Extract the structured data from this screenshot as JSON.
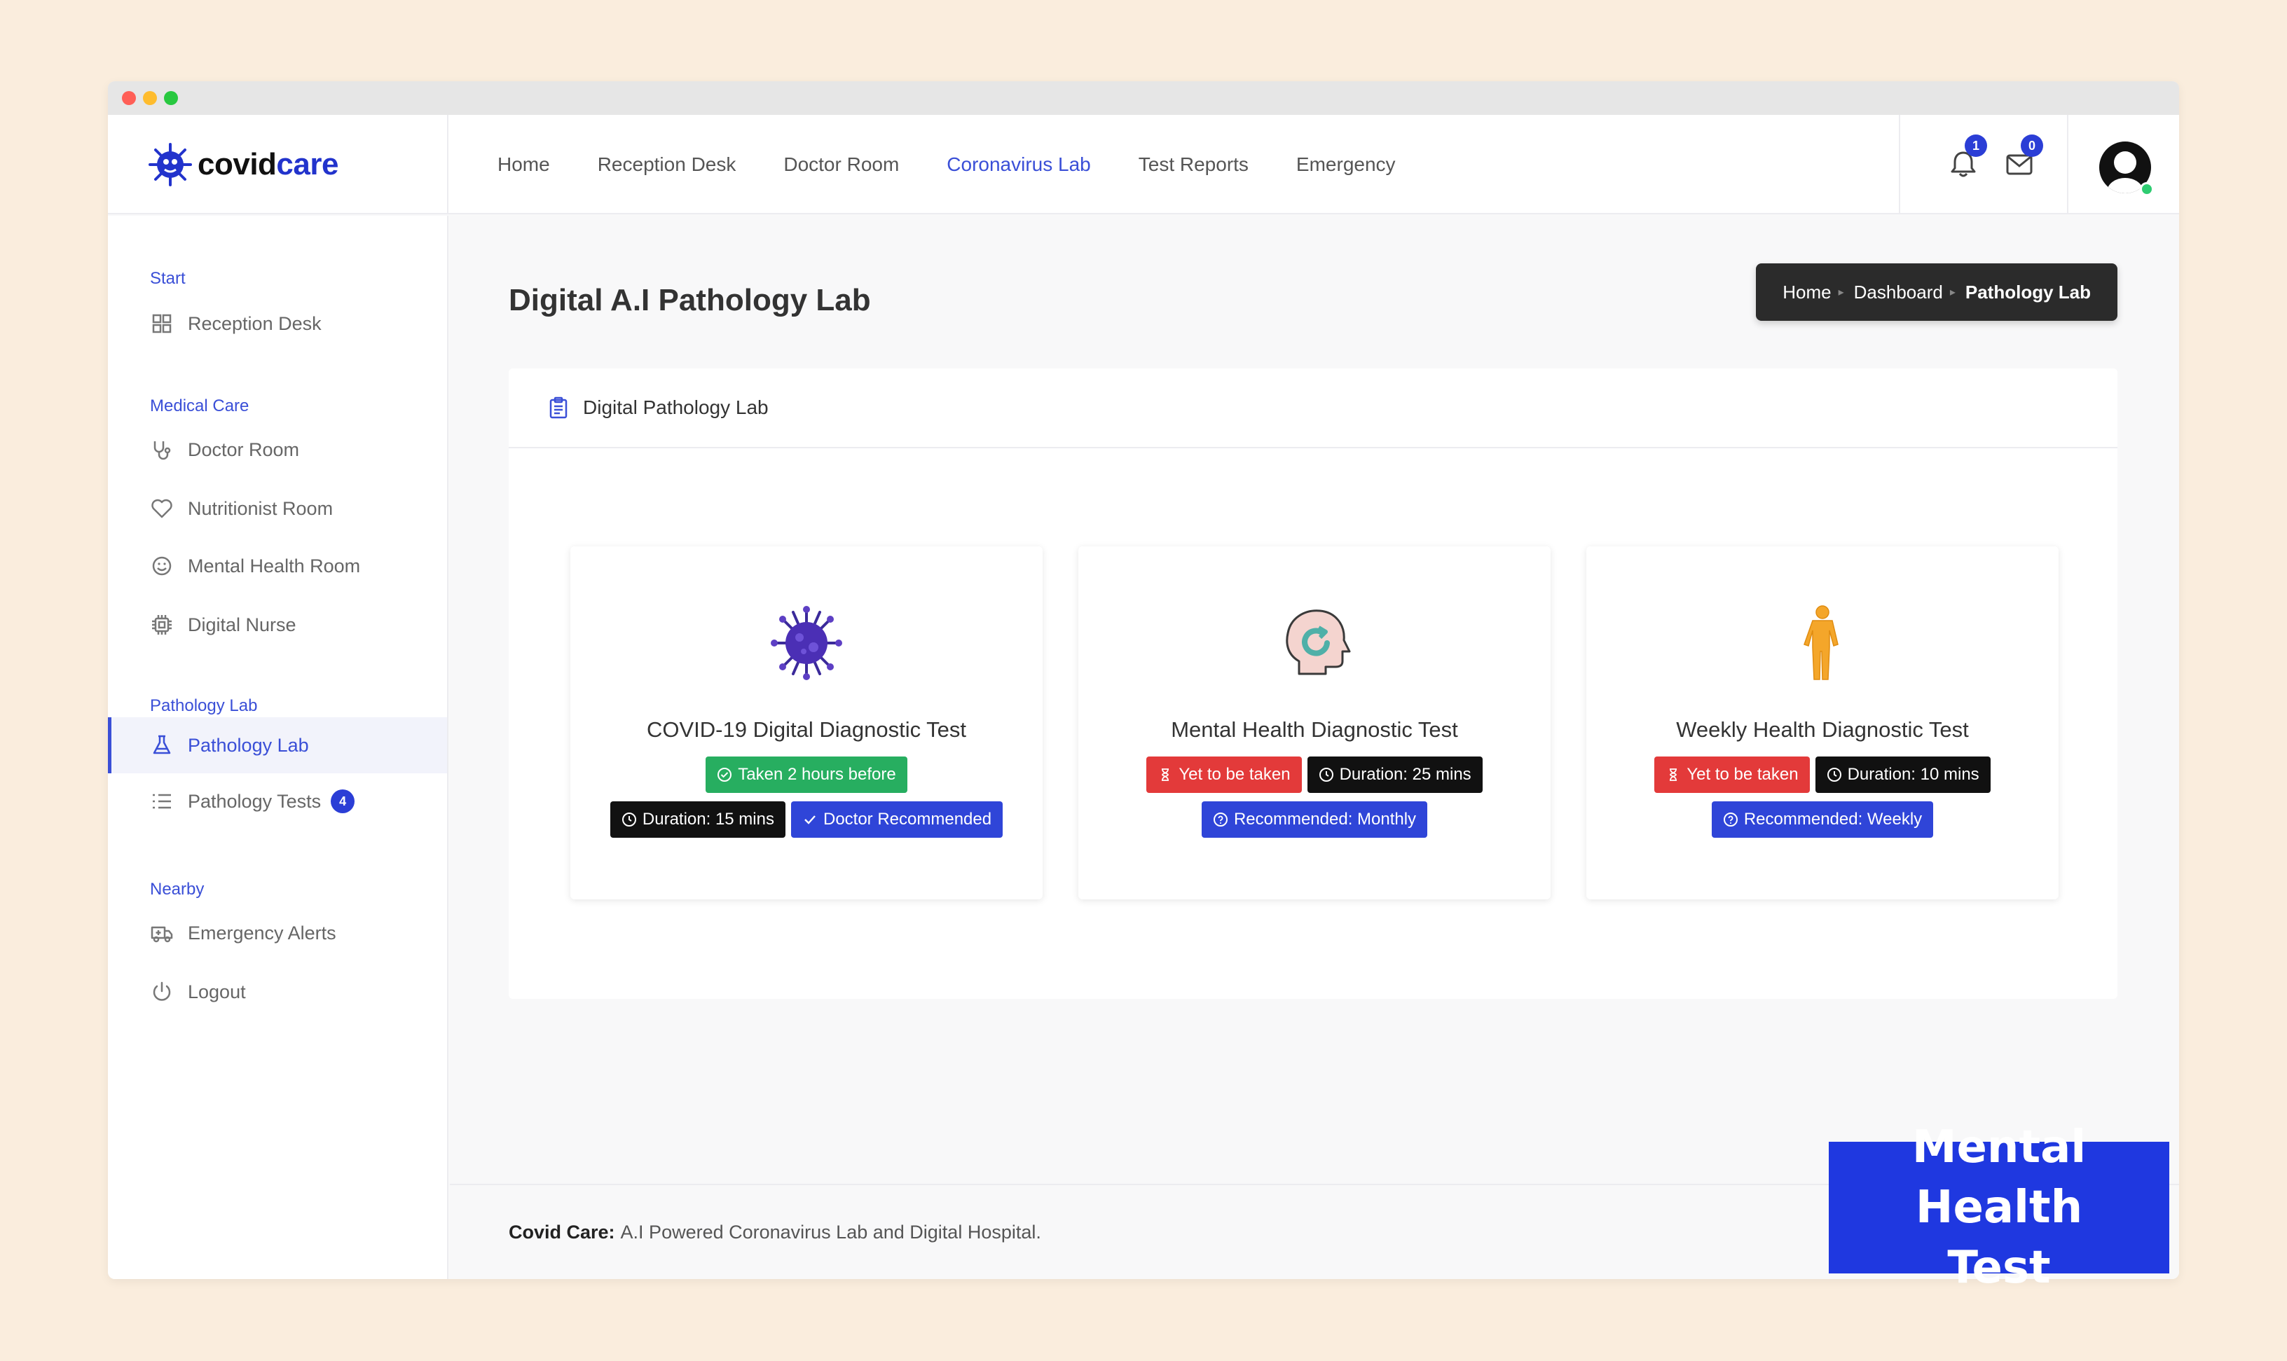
{
  "brand": {
    "part1": "covid",
    "part2": "care"
  },
  "nav": [
    {
      "label": "Home",
      "active": false
    },
    {
      "label": "Reception Desk",
      "active": false
    },
    {
      "label": "Doctor Room",
      "active": false
    },
    {
      "label": "Coronavirus Lab",
      "active": true
    },
    {
      "label": "Test Reports",
      "active": false
    },
    {
      "label": "Emergency",
      "active": false
    }
  ],
  "notifications": {
    "count": "1"
  },
  "messages": {
    "count": "0"
  },
  "sidebar": {
    "sections": [
      {
        "label": "Start"
      },
      {
        "label": "Medical Care"
      },
      {
        "label": "Pathology Lab"
      },
      {
        "label": "Nearby"
      }
    ],
    "items": [
      {
        "label": "Reception Desk",
        "icon": "grid-icon"
      },
      {
        "label": "Doctor Room",
        "icon": "stethoscope-icon"
      },
      {
        "label": "Nutritionist Room",
        "icon": "heart-icon"
      },
      {
        "label": "Mental Health Room",
        "icon": "smile-icon"
      },
      {
        "label": "Digital Nurse",
        "icon": "chip-icon"
      },
      {
        "label": "Pathology Lab",
        "icon": "flask-icon",
        "active": true
      },
      {
        "label": "Pathology Tests",
        "icon": "list-icon",
        "count": "4"
      },
      {
        "label": "Emergency Alerts",
        "icon": "ambulance-icon"
      },
      {
        "label": "Logout",
        "icon": "power-icon"
      }
    ]
  },
  "page": {
    "title": "Digital A.I Pathology Lab"
  },
  "breadcrumb": {
    "home": "Home",
    "dashboard": "Dashboard",
    "current": "Pathology Lab"
  },
  "panel": {
    "title": "Digital Pathology Lab"
  },
  "cards": [
    {
      "title": "COVID-19 Digital Diagnostic Test",
      "status": "Taken 2 hours before",
      "duration": "Duration: 15 mins",
      "recommend": "Doctor Recommended"
    },
    {
      "title": "Mental Health Diagnostic Test",
      "status": "Yet to be taken",
      "duration": "Duration: 25 mins",
      "recommend": "Recommended: Monthly"
    },
    {
      "title": "Weekly Health Diagnostic Test",
      "status": "Yet to be taken",
      "duration": "Duration: 10 mins",
      "recommend": "Recommended: Weekly"
    }
  ],
  "footer": {
    "brand": "Covid Care:",
    "text": "A.I Powered Coronavirus Lab and Digital Hospital."
  },
  "overlay": {
    "line1": "Mental Health",
    "line2": "Test"
  },
  "colors": {
    "accent": "#3a4fd7",
    "green": "#27ae60",
    "red": "#e33a3a",
    "black": "#111111",
    "blue": "#2f45d8"
  }
}
